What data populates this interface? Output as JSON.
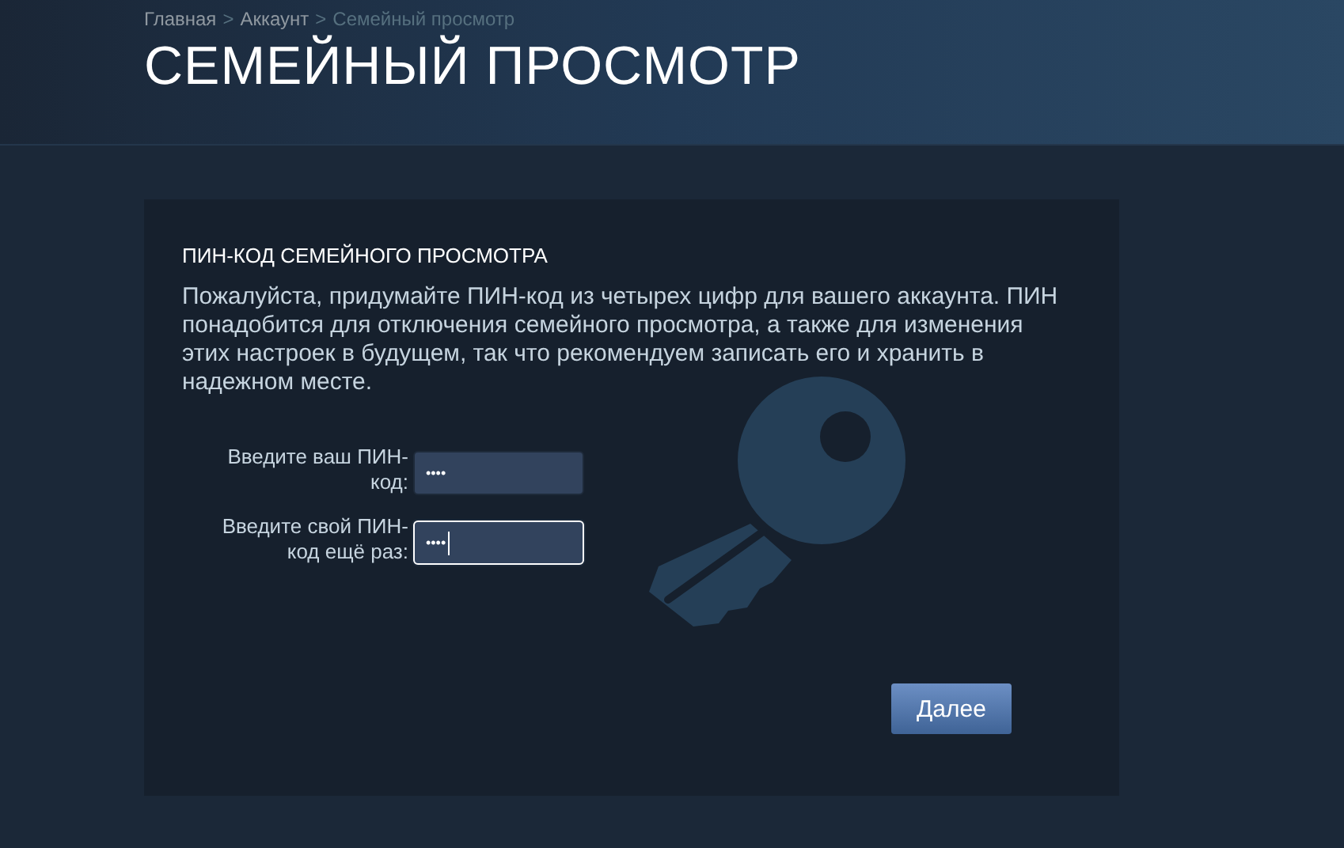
{
  "breadcrumbs": [
    {
      "label": "Главная",
      "current": false
    },
    {
      "label": "Аккаунт",
      "current": false
    },
    {
      "label": "Семейный просмотр",
      "current": true
    }
  ],
  "breadcrumb_separator": ">",
  "page_title": "СЕМЕЙНЫЙ ПРОСМОТР",
  "panel": {
    "heading": "ПИН-КОД СЕМЕЙНОГО ПРОСМОТРА",
    "description": "Пожалуйста, придумайте ПИН-код из четырех цифр для вашего аккаунта. ПИН понадобится для отключения семейного просмотра, а также для изменения этих настроек в будущем, так что рекомендуем записать его и хранить в надежном месте.",
    "fields": [
      {
        "label": "Введите ваш ПИН-код:",
        "value": "••••",
        "focused": false
      },
      {
        "label": "Введите свой ПИН-код ещё раз:",
        "value": "••••",
        "focused": true
      }
    ],
    "button": "Далее"
  }
}
